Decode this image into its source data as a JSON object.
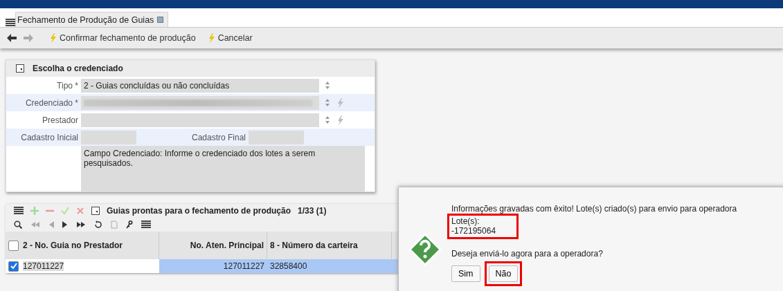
{
  "tab": {
    "title": "Fechamento de Produção de Guias",
    "selected": true
  },
  "toolbar": {
    "actions": [
      {
        "label": "Confirmar fechamento de produção"
      },
      {
        "label": "Cancelar"
      }
    ]
  },
  "form": {
    "title": "Escolha o credenciado",
    "fields": [
      {
        "kind": "select",
        "label": "Tipo *",
        "value": "2 - Guias concluídas ou não concluídas",
        "highlighted": false,
        "lookup": false
      },
      {
        "kind": "redacted",
        "label": "Credenciado *",
        "highlighted": true,
        "lookup": true
      },
      {
        "kind": "select",
        "label": "Prestador",
        "highlighted": false,
        "lookup": true
      }
    ],
    "range": {
      "start_label": "Cadastro Inicial",
      "end_label": "Cadastro Final"
    },
    "help": "Campo Credenciado: Informe o credenciado dos lotes a serem pesquisados."
  },
  "grid": {
    "title": "Guias prontas para o fechamento de produção",
    "count": "1/33 (1)",
    "select_all_checked": false,
    "columns": [
      "2 - No. Guia no Prestador",
      "No. Aten. Principal",
      "8 - Número da carteira"
    ],
    "rows": [
      {
        "selected": true,
        "cells": [
          "127011227",
          "127011227",
          "32858400"
        ]
      }
    ]
  },
  "dialog": {
    "message": "Informações gravadas com êxito! Lote(s) criado(s) para envio para operadora",
    "lote_label": "Lote(s):",
    "lote_value": "-172195064",
    "question": "Deseja enviá-lo agora para a operadora?",
    "buttons": [
      {
        "label": "Sim",
        "highlighted": false
      },
      {
        "label": "Não",
        "highlighted": true
      }
    ]
  }
}
